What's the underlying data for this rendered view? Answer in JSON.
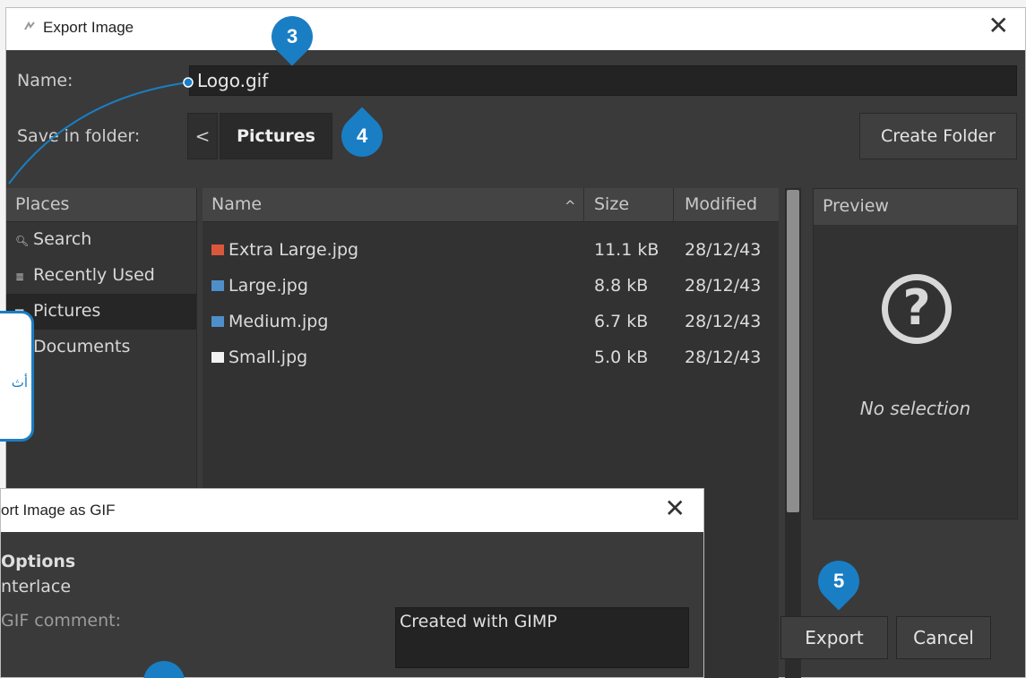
{
  "export_dialog": {
    "title": "Export Image",
    "name_label": "Name:",
    "name_value": "Logo.gif",
    "save_in_folder_label": "Save in folder:",
    "breadcrumb_back": "<",
    "breadcrumb_current": "Pictures",
    "create_folder_label": "Create Folder",
    "places": {
      "header": "Places",
      "items": [
        {
          "label": "Search",
          "icon": "search-icon"
        },
        {
          "label": "Recently Used",
          "icon": "recent-icon"
        },
        {
          "label": "Pictures",
          "icon": "folder-icon",
          "selected": true
        },
        {
          "label": "Documents",
          "icon": "folder-icon"
        }
      ]
    },
    "files": {
      "columns": {
        "name": "Name",
        "sort_arrow": "^",
        "size": "Size",
        "modified": "Modified"
      },
      "rows": [
        {
          "name": "Extra Large.jpg",
          "size": "11.1 kB",
          "modified": "28/12/43",
          "thumb_color": "#d9583c"
        },
        {
          "name": "Large.jpg",
          "size": "8.8 kB",
          "modified": "28/12/43",
          "thumb_color": "#4f8fc9"
        },
        {
          "name": "Medium.jpg",
          "size": "6.7 kB",
          "modified": "28/12/43",
          "thumb_color": "#4f8fc9"
        },
        {
          "name": "Small.jpg",
          "size": "5.0 kB",
          "modified": "28/12/43",
          "thumb_color": "#f2f2f2"
        }
      ]
    },
    "preview": {
      "header": "Preview",
      "no_selection": "No selection",
      "icon": "question-mark-icon"
    },
    "buttons": {
      "export": "Export",
      "cancel": "Cancel"
    }
  },
  "gif_dialog": {
    "title": "ort Image as GIF",
    "options_title": "Options",
    "interlace_label": "nterlace",
    "comment_label": "GIF comment:",
    "comment_value": "Created with GIMP"
  },
  "callouts": {
    "step3": "3",
    "step4": "4",
    "step5": "5",
    "side_text": "أث"
  },
  "colors": {
    "dialog_bg": "#3a3a3a",
    "callout_blue": "#1a7ec4"
  }
}
